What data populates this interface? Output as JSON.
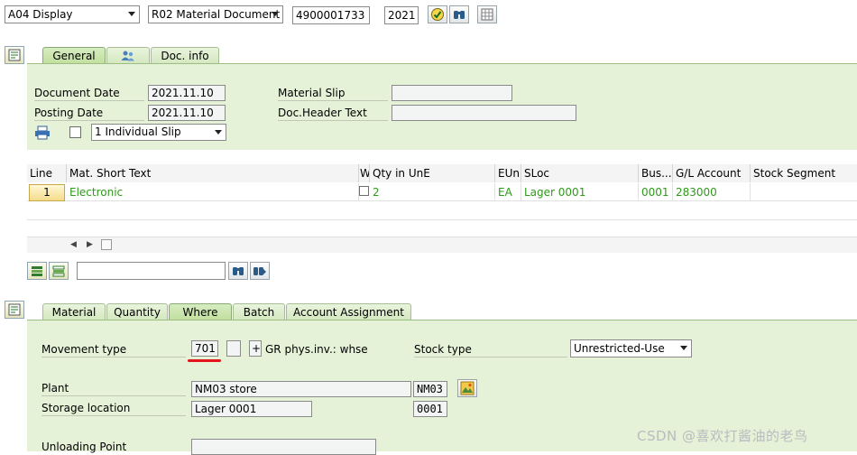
{
  "toolbar": {
    "action_select": "A04 Display",
    "document_type_select": "R02 Material Document",
    "document_number": "4900001733",
    "document_year": "2021"
  },
  "header_tabs": [
    {
      "label": "General"
    },
    {
      "label": ""
    },
    {
      "label": "Doc. info"
    }
  ],
  "header": {
    "document_date_label": "Document Date",
    "document_date": "2021.11.10",
    "posting_date_label": "Posting Date",
    "posting_date": "2021.11.10",
    "material_slip_label": "Material Slip",
    "material_slip": "",
    "doc_header_text_label": "Doc.Header Text",
    "doc_header_text": "",
    "print_option": "1 Individual Slip"
  },
  "items_table": {
    "columns": [
      "Line",
      "Mat. Short Text",
      "W",
      "Qty in UnE",
      "EUn",
      "SLoc",
      "Bus...",
      "G/L Account",
      "Stock Segment"
    ],
    "rows": [
      {
        "line": "1",
        "mat_short_text": "Electronic",
        "qty": "2",
        "eun": "EA",
        "sloc": "Lager 0001",
        "bus": "0001",
        "gl_account": "283000",
        "stock_segment": ""
      }
    ],
    "search_value": ""
  },
  "detail_tabs": [
    {
      "label": "Material"
    },
    {
      "label": "Quantity"
    },
    {
      "label": "Where"
    },
    {
      "label": "Batch"
    },
    {
      "label": "Account Assignment"
    }
  ],
  "detail": {
    "movement_type_label": "Movement type",
    "movement_type": "701",
    "movement_plus": "+",
    "movement_type_text": "GR phys.inv.: whse",
    "stock_type_label": "Stock type",
    "stock_type": "Unrestricted-Use",
    "plant_label": "Plant",
    "plant_name": "NM03 store",
    "plant_code": "NM03",
    "storage_location_label": "Storage location",
    "storage_location_name": "Lager 0001",
    "storage_location_code": "0001",
    "unloading_point_label": "Unloading Point",
    "unloading_point": ""
  },
  "watermark": "CSDN @喜欢打酱油的老鸟",
  "colors": {
    "area_green": "#e6f2d8",
    "value_green": "#2f9a1a",
    "annotation_red": "#e3141a"
  }
}
